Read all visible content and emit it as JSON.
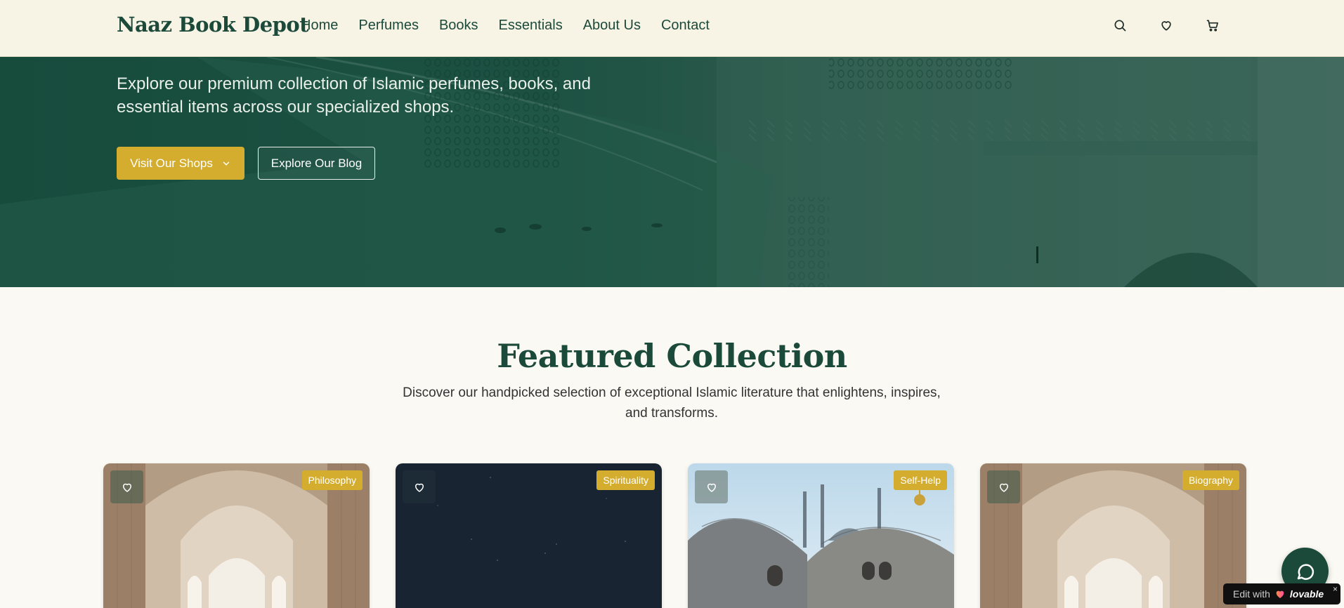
{
  "header": {
    "logo": "Naaz Book Depot",
    "nav": [
      "Home",
      "Perfumes",
      "Books",
      "Essentials",
      "About Us",
      "Contact"
    ],
    "icons": [
      "search-icon",
      "heart-icon",
      "cart-icon"
    ]
  },
  "hero": {
    "subtitle": "Explore our premium collection of Islamic perfumes, books, and essential items across our specialized shops.",
    "primary_button": "Visit Our Shops",
    "secondary_button": "Explore Our Blog"
  },
  "featured": {
    "title": "Featured Collection",
    "description": "Discover our handpicked selection of exceptional Islamic literature that enlightens, inspires, and transforms.",
    "cards": [
      {
        "tag": "Philosophy"
      },
      {
        "tag": "Spirituality"
      },
      {
        "tag": "Self-Help"
      },
      {
        "tag": "Biography"
      }
    ]
  },
  "widgets": {
    "edit_with": "Edit with",
    "brand": "lovable",
    "close": "×"
  },
  "colors": {
    "primary": "#1c4a3a",
    "accent": "#d4ad2f",
    "header_bg": "#f7f3e5",
    "page_bg": "#fbf9f3"
  }
}
